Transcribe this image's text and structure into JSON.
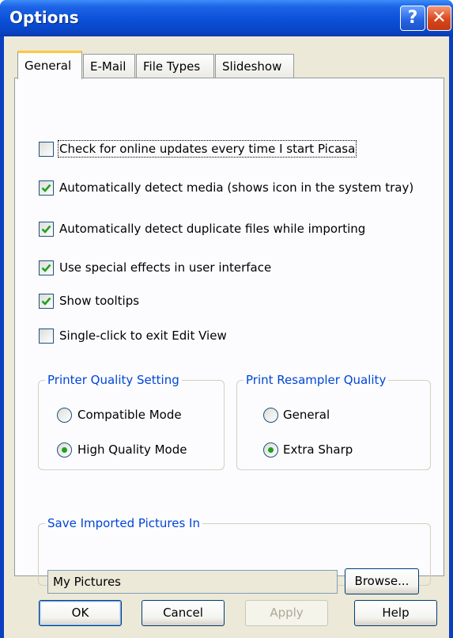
{
  "window": {
    "title": "Options"
  },
  "titlebar": {
    "help_glyph": "?",
    "close_glyph": "✕",
    "help_icon": "help-icon",
    "close_icon": "close-icon"
  },
  "tabs": [
    {
      "label": "General",
      "active": true
    },
    {
      "label": "E-Mail",
      "active": false
    },
    {
      "label": "File Types",
      "active": false
    },
    {
      "label": "Slideshow",
      "active": false
    }
  ],
  "options": [
    {
      "label": "Check for online updates every time I start Picasa",
      "checked": false
    },
    {
      "label": "Automatically detect media (shows icon in the system tray)",
      "checked": true
    },
    {
      "label": "Automatically detect duplicate files while importing",
      "checked": true
    },
    {
      "label": "Use special effects in user interface",
      "checked": true
    },
    {
      "label": "Show tooltips",
      "checked": true
    },
    {
      "label": "Single-click to exit Edit View",
      "checked": false
    }
  ],
  "printer_quality": {
    "legend": "Printer Quality Setting",
    "options": [
      {
        "label": "Compatible Mode",
        "selected": false
      },
      {
        "label": "High Quality Mode",
        "selected": true
      }
    ]
  },
  "resampler_quality": {
    "legend": "Print Resampler Quality",
    "options": [
      {
        "label": "General",
        "selected": false
      },
      {
        "label": "Extra Sharp",
        "selected": true
      }
    ]
  },
  "save_location": {
    "legend": "Save Imported Pictures In",
    "value": "My Pictures",
    "browse_label": "Browse..."
  },
  "buttons": {
    "ok": "OK",
    "cancel": "Cancel",
    "apply": "Apply",
    "help": "Help"
  },
  "colors": {
    "title_bar": "#0a50d8",
    "dialog_bg": "#ece9d8",
    "group_legend": "#0046d5",
    "check_mark": "#21a121",
    "active_tab_accent": "#ffc83c"
  }
}
